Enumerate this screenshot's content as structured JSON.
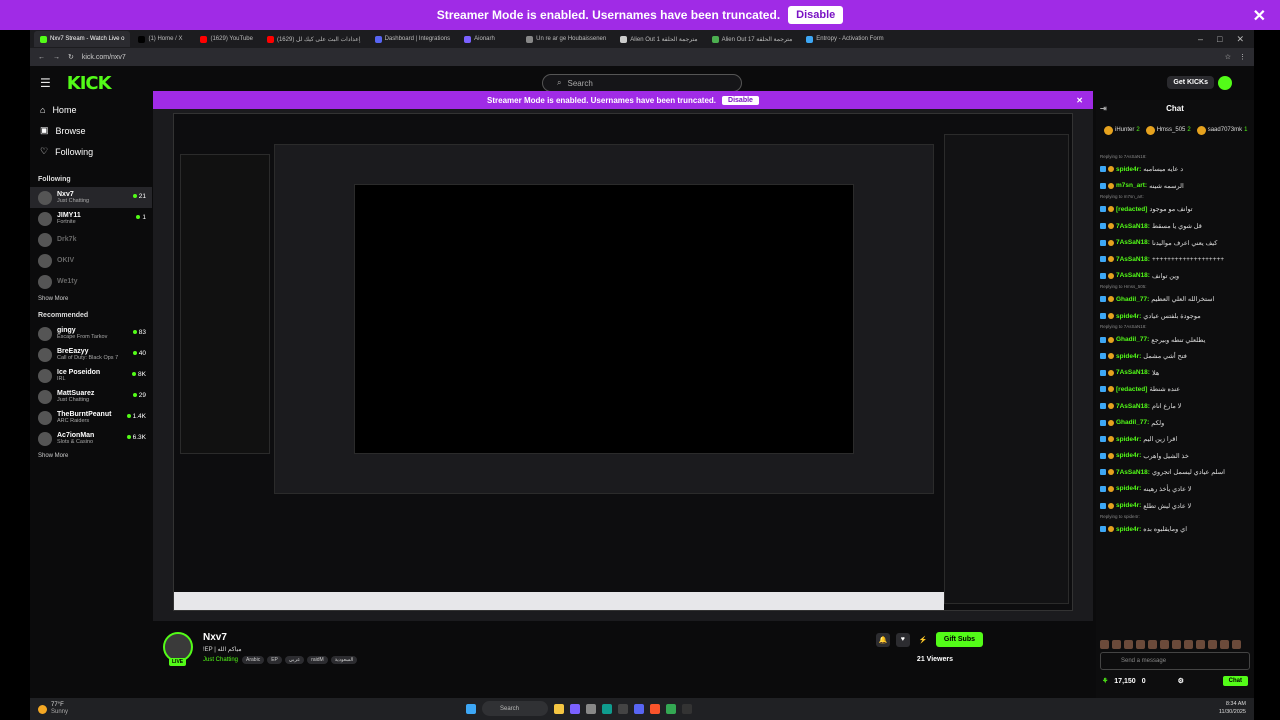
{
  "banner": {
    "text": "Streamer Mode is enabled. Usernames have been truncated.",
    "disable": "Disable"
  },
  "browser": {
    "tabs": [
      {
        "label": "Nxv7 Stream - Watch Live o",
        "color": "#53fc18",
        "active": true
      },
      {
        "label": "(1) Home / X",
        "color": "#000000"
      },
      {
        "label": "(1629) YouTube",
        "color": "#ff0000"
      },
      {
        "label": "إعدادات البث على كيك لل (1629)",
        "color": "#ff0000"
      },
      {
        "label": "Dashboard | Integrations",
        "color": "#5865f2"
      },
      {
        "label": "Aionarh",
        "color": "#7b61ff"
      },
      {
        "label": "Un re ar ge Houbaissenen",
        "color": "#888888"
      },
      {
        "label": "Alien Out 1 مترجمة الحلقة",
        "color": "#cccccc"
      },
      {
        "label": "Alien Out 17 مترجمة الحلقة",
        "color": "#4caf50"
      },
      {
        "label": "Entropy - Activation Form",
        "color": "#3da7f5"
      }
    ],
    "url": "kick.com/nxv7"
  },
  "kick": {
    "logo": "KICK",
    "search_placeholder": "Search",
    "get_kicks": "Get KICKs",
    "nav": {
      "home": "Home",
      "browse": "Browse",
      "following": "Following"
    },
    "following_title": "Following",
    "following": [
      {
        "name": "Nxv7",
        "cat": "Just Chatting",
        "viewers": "21",
        "selected": true
      },
      {
        "name": "JIMY11",
        "cat": "Fortnite",
        "viewers": "1"
      },
      {
        "name": "Drk7k",
        "cat": "",
        "viewers": "",
        "offline": true
      },
      {
        "name": "OKIV",
        "cat": "",
        "viewers": "",
        "offline": true
      },
      {
        "name": "We1ty",
        "cat": "",
        "viewers": "",
        "offline": true
      }
    ],
    "show_more": "Show More",
    "recommended_title": "Recommended",
    "recommended": [
      {
        "name": "gingy",
        "cat": "Escape From Tarkov",
        "viewers": "83"
      },
      {
        "name": "BreEazyy",
        "cat": "Call of Duty: Black Ops 7",
        "viewers": "40"
      },
      {
        "name": "Ice Poseidon",
        "cat": "IRL",
        "viewers": "8K"
      },
      {
        "name": "MattSuarez",
        "cat": "Just Chatting",
        "viewers": "29"
      },
      {
        "name": "TheBurntPeanut",
        "cat": "ARC Raiders",
        "viewers": "1.4K"
      },
      {
        "name": "Ac7ionMan",
        "cat": "Slots & Casino",
        "viewers": "6.3K"
      }
    ],
    "show_more_2": "Show More"
  },
  "stream": {
    "name": "Nxv7",
    "title": "!EP | مياكم الله",
    "category": "Just Chatting",
    "tags": [
      "Arabic",
      "EP",
      "عربي",
      "raidM",
      "السعودية"
    ],
    "gift_subs": "Gift Subs",
    "viewers": "21 Viewers",
    "live": "LIVE"
  },
  "chat": {
    "title": "Chat",
    "pinned": [
      {
        "name": "iHunter",
        "n": "2"
      },
      {
        "name": "Hmss_505",
        "n": "2"
      },
      {
        "name": "saad7073mk",
        "n": "1"
      }
    ],
    "messages": [
      {
        "reply": "Replying to 7AsSaN18:",
        "user": "spide4r:",
        "text": "د عايه ميسامبه"
      },
      {
        "reply": "",
        "user": "m7sn_art:",
        "text": "الرسمه شينه"
      },
      {
        "reply": "Replying to m7sn_art:",
        "user": "[redacted]",
        "text": "توانف مو موجود"
      },
      {
        "reply": "",
        "user": "7AsSaN18:",
        "text": "قل شوي يا مسقط"
      },
      {
        "reply": "",
        "user": "7AsSaN18:",
        "text": "كيف يعني اعرف مواليدنا"
      },
      {
        "reply": "",
        "user": "7AsSaN18:",
        "text": "+++++++++++++++++++"
      },
      {
        "reply": "",
        "user": "7AsSaN18:",
        "text": "وين توانف"
      },
      {
        "reply": "Replying to Hmss_505:",
        "user": "Ghadil_77:",
        "text": "استخرالله العلي العظيم"
      },
      {
        "reply": "",
        "user": "spide4r:",
        "text": "موجودة بلفتس عيادي"
      },
      {
        "reply": "Replying to 7AsSaN18:",
        "user": "Ghadil_77:",
        "text": "يطلعلي تنطه وبيرجع"
      },
      {
        "reply": "",
        "user": "spide4r:",
        "text": "فتح أشي مشمل"
      },
      {
        "reply": "",
        "user": "7AsSaN18:",
        "text": "هلا"
      },
      {
        "reply": "",
        "user": "[redacted]",
        "text": "عنده شنطة"
      },
      {
        "reply": "",
        "user": "7AsSaN18:",
        "text": "لا مارع انام"
      },
      {
        "reply": "",
        "user": "Ghadil_77:",
        "text": "ولكم"
      },
      {
        "reply": "",
        "user": "spide4r:",
        "text": "اقرا زين اليم"
      },
      {
        "reply": "",
        "user": "spide4r:",
        "text": "خذ الشيل واهرب"
      },
      {
        "reply": "",
        "user": "7AsSaN18:",
        "text": "اسلم عيادي ليسمل اتجروي"
      },
      {
        "reply": "",
        "user": "spide4r:",
        "text": "لا عادي يأخذ رهينه"
      },
      {
        "reply": "",
        "user": "spide4r:",
        "text": "لا عادي ليش تطلع"
      },
      {
        "reply": "Replying to spide4r:",
        "user": "spide4r:",
        "text": "اي ومايقلبوه بده"
      }
    ],
    "input_placeholder": "Send a message",
    "kicks": "17,150",
    "zero": "0",
    "chat_button": "Chat"
  },
  "taskbar": {
    "temp": "77°F",
    "weather": "Sunny",
    "search": "Search",
    "time": "8:34 AM",
    "date": "11/30/2025"
  }
}
